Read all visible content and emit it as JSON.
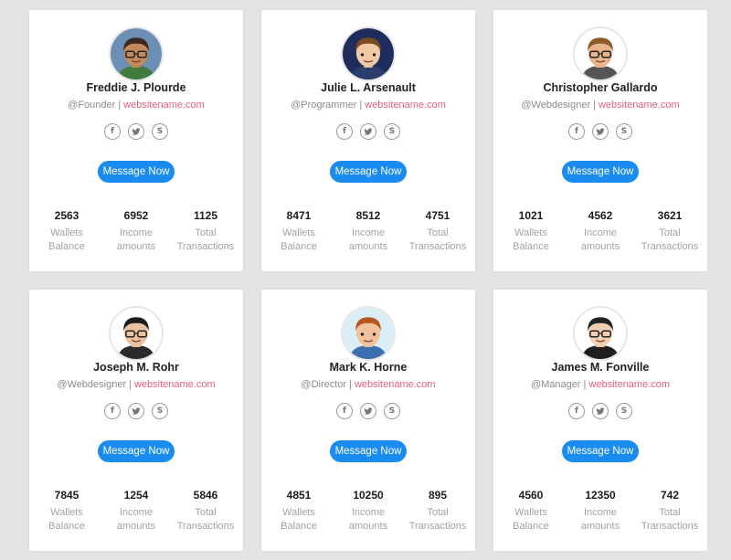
{
  "cards": [
    {
      "name": "Freddie J. Plourde",
      "role": "@Founder",
      "sep": "|",
      "site": "websitename.com",
      "button": "Message Now",
      "avatar": {
        "bg": "#6b8fb5",
        "skin": "#c58a5a",
        "hair": "#3b2a1e",
        "shirt": "#3f7d3c",
        "glasses": true
      },
      "stats": [
        {
          "value": "2563",
          "label": "Wallets\nBalance"
        },
        {
          "value": "6952",
          "label": "Income\namounts"
        },
        {
          "value": "1125",
          "label": "Total\nTransactions"
        }
      ]
    },
    {
      "name": "Julie L. Arsenault",
      "role": "@Programmer",
      "sep": "|",
      "site": "websitename.com",
      "button": "Message Now",
      "avatar": {
        "bg": "#1f2d5c",
        "skin": "#f1c9a6",
        "hair": "#7a4a20",
        "shirt": "#2c3e6b",
        "glasses": false
      },
      "stats": [
        {
          "value": "8471",
          "label": "Wallets\nBalance"
        },
        {
          "value": "8512",
          "label": "Income\namounts"
        },
        {
          "value": "4751",
          "label": "Total\nTransactions"
        }
      ]
    },
    {
      "name": "Christopher Gallardo",
      "role": "@Webdesigner",
      "sep": "|",
      "site": "websitename.com",
      "button": "Message Now",
      "avatar": {
        "bg": "#ffffff",
        "skin": "#e8b48a",
        "hair": "#8a5a2b",
        "shirt": "#555555",
        "glasses": true
      },
      "stats": [
        {
          "value": "1021",
          "label": "Wallets\nBalance"
        },
        {
          "value": "4562",
          "label": "Income\namounts"
        },
        {
          "value": "3621",
          "label": "Total\nTransactions"
        }
      ]
    },
    {
      "name": "Joseph M. Rohr",
      "role": "@Webdesigner",
      "sep": "|",
      "site": "websitename.com",
      "button": "Message Now",
      "avatar": {
        "bg": "#ffffff",
        "skin": "#e9c3a0",
        "hair": "#1e1e1e",
        "shirt": "#2b2b2b",
        "glasses": true
      },
      "stats": [
        {
          "value": "7845",
          "label": "Wallets\nBalance"
        },
        {
          "value": "1254",
          "label": "Income\namounts"
        },
        {
          "value": "5846",
          "label": "Total\nTransactions"
        }
      ]
    },
    {
      "name": "Mark K. Horne",
      "role": "@Director",
      "sep": "|",
      "site": "websitename.com",
      "button": "Message Now",
      "avatar": {
        "bg": "#d9eef7",
        "skin": "#f0c19a",
        "hair": "#b5561f",
        "shirt": "#3b6fb0",
        "glasses": false
      },
      "stats": [
        {
          "value": "4851",
          "label": "Wallets\nBalance"
        },
        {
          "value": "10250",
          "label": "Income\namounts"
        },
        {
          "value": "895",
          "label": "Total\nTransactions"
        }
      ]
    },
    {
      "name": "James M. Fonville",
      "role": "@Manager",
      "sep": "|",
      "site": "websitename.com",
      "button": "Message Now",
      "avatar": {
        "bg": "#ffffff",
        "skin": "#f2cfb0",
        "hair": "#222222",
        "shirt": "#1f1f1f",
        "glasses": true
      },
      "stats": [
        {
          "value": "4560",
          "label": "Wallets\nBalance"
        },
        {
          "value": "12350",
          "label": "Income\namounts"
        },
        {
          "value": "742",
          "label": "Total\nTransactions"
        }
      ]
    }
  ],
  "social_icons": [
    "facebook-icon",
    "twitter-icon",
    "skype-icon"
  ],
  "colors": {
    "accent": "#1a8cf0",
    "link": "#e4607f",
    "page_bg": "#e3e3e3"
  }
}
